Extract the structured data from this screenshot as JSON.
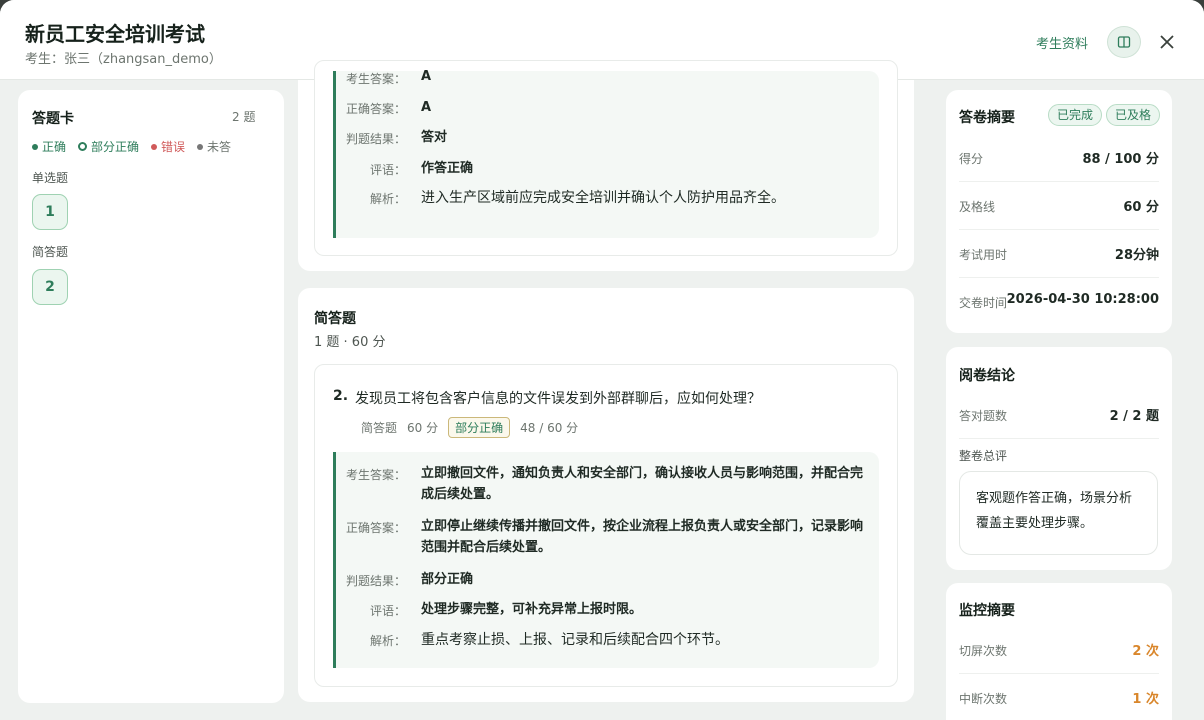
{
  "header": {
    "title": "新员工安全培训考试",
    "subtitle": "考生：张三（zhangsan_demo）",
    "materials_link": "考生资料",
    "book_icon": "book-icon",
    "close_icon": "close-icon"
  },
  "answer_card": {
    "title": "答题卡",
    "count": "2 题",
    "legend": [
      {
        "label": "正确",
        "color": "#2e7d5b",
        "style": "dot"
      },
      {
        "label": "部分正确",
        "color": "#2e7d5b",
        "style": "ring"
      },
      {
        "label": "错误",
        "color": "#d05a5a",
        "style": "dot"
      },
      {
        "label": "未答",
        "color": "#777777",
        "style": "dot"
      }
    ],
    "sections": [
      {
        "label": "单选题",
        "questions": [
          "1"
        ]
      },
      {
        "label": "简答题",
        "questions": [
          "2"
        ]
      }
    ]
  },
  "question1": {
    "clipped_label": "考生答案：",
    "clipped_value": "A",
    "correct_label": "正确答案：",
    "correct_value": "A",
    "result_label": "判题结果：",
    "result_value": "答对",
    "comment_label": "评语：",
    "comment_value": "作答正确",
    "analysis_label": "解析：",
    "analysis_value": "进入生产区域前应完成安全培训并确认个人防护用品齐全。"
  },
  "section2": {
    "title": "简答题",
    "meta": "1 题 · 60 分"
  },
  "question2": {
    "number": "2.",
    "text": "发现员工将包含客户信息的文件误发到外部群聊后，应如何处理？",
    "type": "简答题",
    "points": "60 分",
    "status": "部分正确",
    "score": "48 / 60 分",
    "answer_label": "考生答案：",
    "answer_value": "立即撤回文件，通知负责人和安全部门，确认接收人员与影响范围，并配合完成后续处置。",
    "correct_label": "正确答案：",
    "correct_value": "立即停止继续传播并撤回文件，按企业流程上报负责人或安全部门，记录影响范围并配合后续处置。",
    "result_label": "判题结果：",
    "result_value": "部分正确",
    "comment_label": "评语：",
    "comment_value": "处理步骤完整，可补充异常上报时限。",
    "analysis_label": "解析：",
    "analysis_value": "重点考察止损、上报、记录和后续配合四个环节。"
  },
  "summary": {
    "title": "答卷摘要",
    "badges": [
      "已完成",
      "已及格"
    ],
    "rows": [
      {
        "k": "得分",
        "v": "88 / 100 分"
      },
      {
        "k": "及格线",
        "v": "60 分"
      },
      {
        "k": "考试用时",
        "v": "28分钟"
      },
      {
        "k": "交卷时间",
        "v": "2026-04-30 10:28:00"
      }
    ]
  },
  "conclusion": {
    "title": "阅卷结论",
    "correct_label": "答对题数",
    "correct_value": "2 / 2 题",
    "overall_label": "整卷总评",
    "overall_text": "客观题作答正确，场景分析覆盖主要处理步骤。"
  },
  "monitor": {
    "title": "监控摘要",
    "rows": [
      {
        "k": "切屏次数",
        "v": "2 次"
      },
      {
        "k": "中断次数",
        "v": "1 次"
      }
    ]
  }
}
